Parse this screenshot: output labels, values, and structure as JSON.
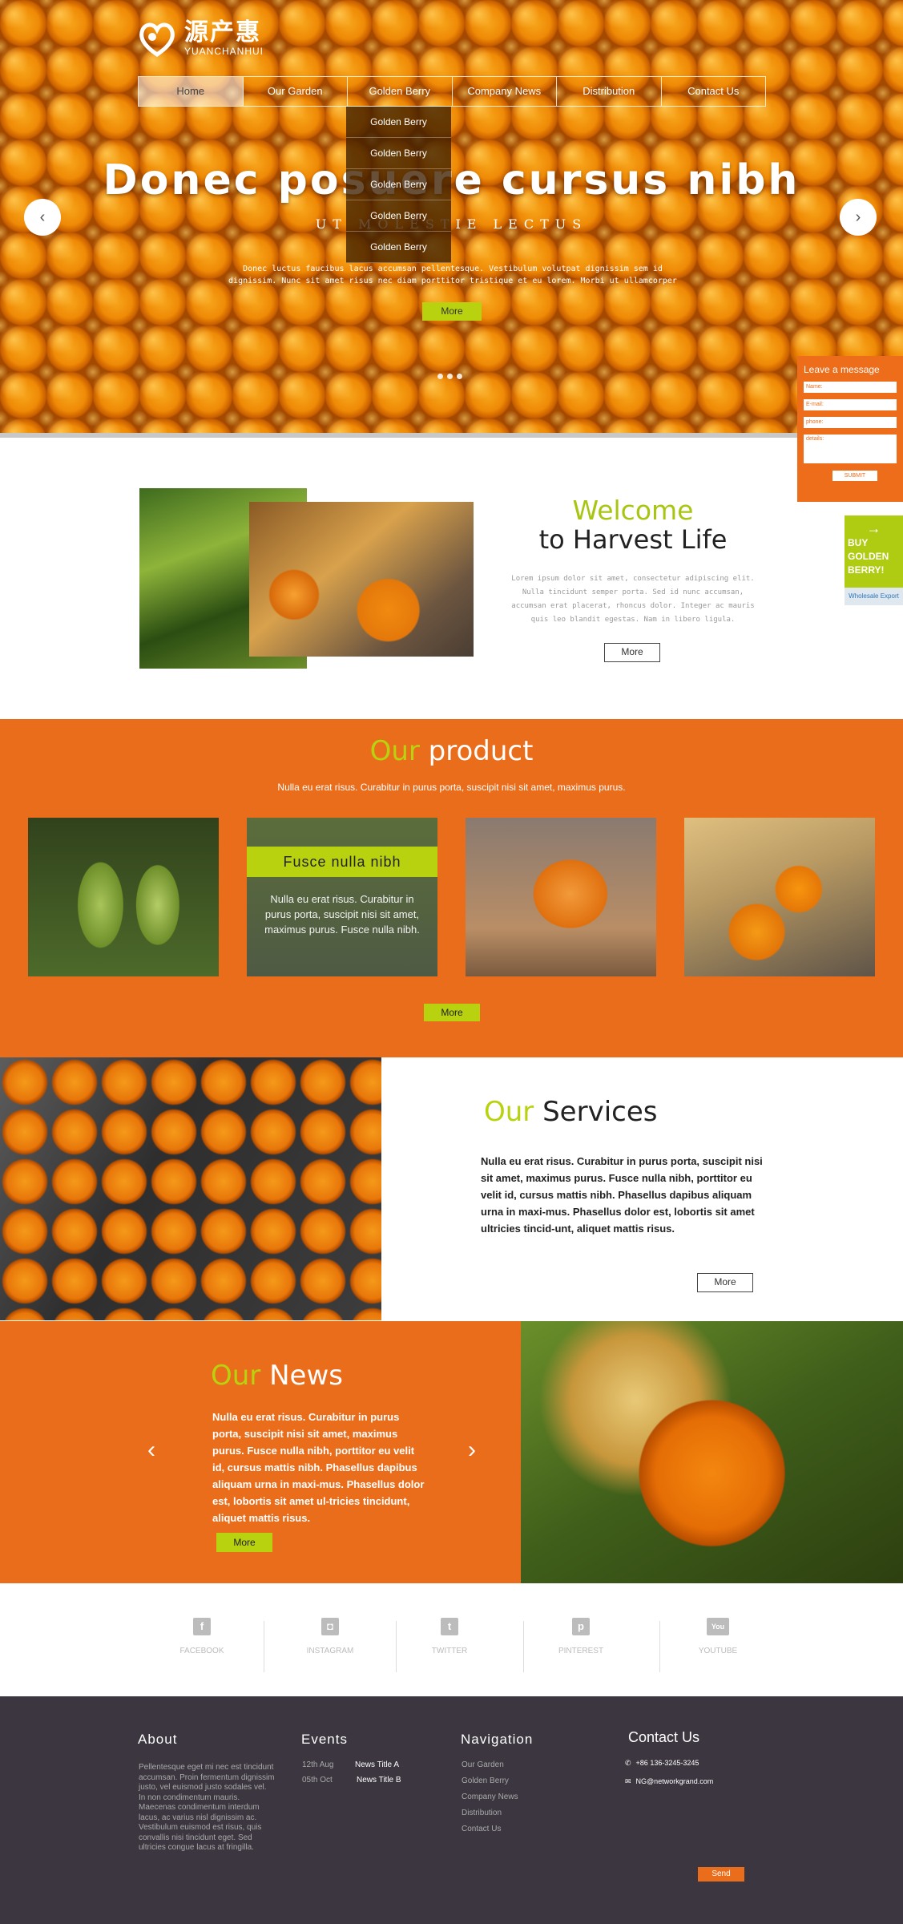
{
  "logo": {
    "cn": "源产惠",
    "en": "YUANCHANHUI"
  },
  "nav": [
    "Home",
    "Our Garden",
    "Golden Berry",
    "Company News",
    "Distribution",
    "Contact Us"
  ],
  "dropdown": [
    "Golden Berry",
    "Golden Berry",
    "Golden Berry",
    "Golden Berry",
    "Golden Berry"
  ],
  "hero": {
    "title": "Donec posuere cursus nibh",
    "subtitle": "UT MOLESTIE LECTUS",
    "desc": "Donec luctus faucibus lacus accumsan pellentesque. Vestibulum volutpat dignissim sem id dignissim. Nunc sit amet risus nec diam porttitor tristique et eu lorem. Morbi ut ullamcorper",
    "more": "More",
    "prev_icon": "chevron-left-icon",
    "next_icon": "chevron-right-icon"
  },
  "message": {
    "title": "Leave a message",
    "name": "Name:",
    "email": "E-mail:",
    "phone": "phone:",
    "details": "details:",
    "submit": "SUBMIT"
  },
  "buy": {
    "line1": "BUY GOLDEN",
    "line2": "BERRY!",
    "wholesale": "Wholesale Export"
  },
  "welcome": {
    "title1": "Welcome",
    "title2": "to Harvest Life",
    "desc": "Lorem ipsum dolor sit amet, consectetur adipiscing elit. Nulla tincidunt semper porta. Sed id nunc accumsan, accumsan erat placerat, rhoncus dolor. Integer ac mauris quis leo blandit egestas. Nam in libero ligula.",
    "more": "More"
  },
  "product": {
    "title_hl": "Our",
    "title_rest": " product",
    "desc": "Nulla eu erat risus. Curabitur in purus porta, suscipit nisi sit amet, maximus purus.",
    "overlay_title": "Fusce nulla nibh",
    "overlay_text": "Nulla eu erat risus. Curabitur in purus porta, suscipit nisi sit amet, maximus purus. Fusce nulla nibh.",
    "more": "More"
  },
  "services": {
    "title_hl": "Our",
    "title_rest": " Services",
    "text": "Nulla eu erat risus. Curabitur in purus porta, suscipit nisi sit amet, maximus purus. Fusce nulla nibh, porttitor eu velit id, cursus mattis nibh. Phasellus dapibus aliquam urna in maxi-mus. Phasellus dolor est, lobortis sit amet ultricies tincid-unt, aliquet mattis risus.",
    "more": "More"
  },
  "news": {
    "title_hl": "Our",
    "title_rest": " News",
    "text": "Nulla eu erat risus. Curabitur in purus porta, suscipit nisi sit amet, maximus purus. Fusce nulla nibh, porttitor eu velit id, cursus mattis nibh. Phasellus dapibus aliquam urna in maxi-mus. Phasellus dolor est, lobortis sit amet ul-tricies tincidunt, aliquet mattis risus.",
    "more": "More"
  },
  "social": [
    {
      "label": "FACEBOOK",
      "glyph": "f"
    },
    {
      "label": "INSTAGRAM",
      "glyph": "◘"
    },
    {
      "label": "TWITTER",
      "glyph": "t"
    },
    {
      "label": "PINTEREST",
      "glyph": "p"
    },
    {
      "label": "YOUTUBE",
      "glyph": "You"
    }
  ],
  "footer": {
    "about_h": "About",
    "about_text": "Pellentesque eget mi nec est tincidunt accumsan. Proin fermentum dignissim justo, vel euismod justo sodales vel. In non condimentum mauris. Maecenas condimentum interdum lacus, ac varius nisl dignissim ac. Vestibulum euismod est risus, quis convallis nisi tincidunt eget. Sed ultricies congue lacus at fringilla.",
    "events_h": "Events",
    "events": [
      {
        "date": "12th Aug",
        "title": "News Title A"
      },
      {
        "date": "05th Oct",
        "title": "News Title B"
      }
    ],
    "nav_h": "Navigation",
    "nav": [
      "Our Garden",
      "Golden Berry",
      "Company News",
      "Distribution",
      "Contact Us"
    ],
    "contact_h": "Contact Us",
    "phone": "+86 136-3245-3245",
    "email": "NG@networkgrand.com",
    "send": "Send"
  },
  "colors": {
    "orange": "#ea6d1b",
    "lime": "#b9d20f",
    "footer": "#3b363f"
  }
}
